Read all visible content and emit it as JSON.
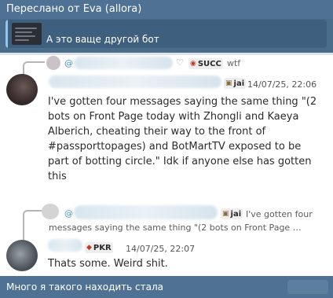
{
  "forward": {
    "title": "Переслано от Eva (allora)",
    "reply_text": "А это ваще другой бот"
  },
  "thread": {
    "reply1": {
      "badge": "SUCC",
      "preview": "wtf"
    },
    "message1": {
      "badge": "jai",
      "timestamp": "14/07/25, 22:06",
      "lines": [
        "I've gotten four messages saying the same thing \"(2",
        "bots on Front Page today with Zhongli and Kaeya",
        "Alberich, cheating their way to the front of",
        "#passporttopages) and BotMartTV exposed to be",
        "part of botting circle.\" Idk if anyone else has gotten",
        "this"
      ]
    },
    "reply2": {
      "badge": "jai",
      "preview_lines": [
        "I've gotten four",
        "messages saying the same thing \"(2 bots on Front Page …"
      ]
    },
    "message2": {
      "badge": "PKR",
      "timestamp": "14/07/25, 22:07",
      "text": "Thats some. Weird shit."
    }
  },
  "caption": {
    "text": "Много я такого находить стала"
  },
  "colors": {
    "chat_bg": "#4a6d8c",
    "accent": "#8fc7f0",
    "card_bg": "#ffffff",
    "mention": "#4a8fc5"
  }
}
